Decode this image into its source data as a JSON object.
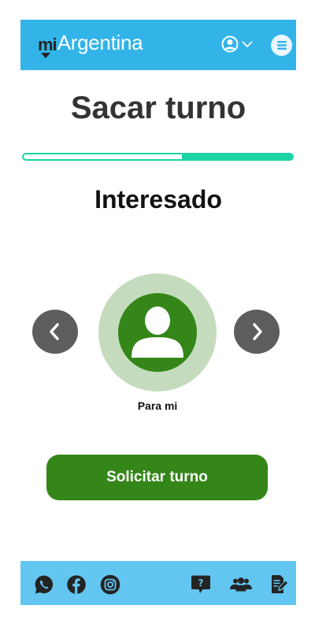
{
  "header": {
    "logo_mi": "mi",
    "logo_name": "Argentina",
    "user_icon": "user-circle-icon",
    "dropdown_icon": "chevron-down-icon",
    "menu_icon": "hamburger-menu-icon"
  },
  "page": {
    "title": "Sacar turno",
    "progress_fraction": 0.41,
    "section_title": "Interesado"
  },
  "carousel": {
    "prev_icon": "chevron-left-icon",
    "next_icon": "chevron-right-icon",
    "selected_label": "Para mi",
    "selected_icon": "person-icon"
  },
  "cta": {
    "label": "Solicitar turno"
  },
  "footer": {
    "left_icons": [
      "whatsapp-icon",
      "facebook-icon",
      "instagram-icon"
    ],
    "right_icons": [
      "help-chat-icon",
      "community-icon",
      "document-edit-icon"
    ]
  },
  "colors": {
    "header_bg": "#33b4e9",
    "footer_bg": "#63c6f0",
    "accent_green": "#348618",
    "light_green": "#c4dcbd",
    "progress_teal": "#1cd3a4",
    "nav_gray": "#5d5d5d"
  }
}
